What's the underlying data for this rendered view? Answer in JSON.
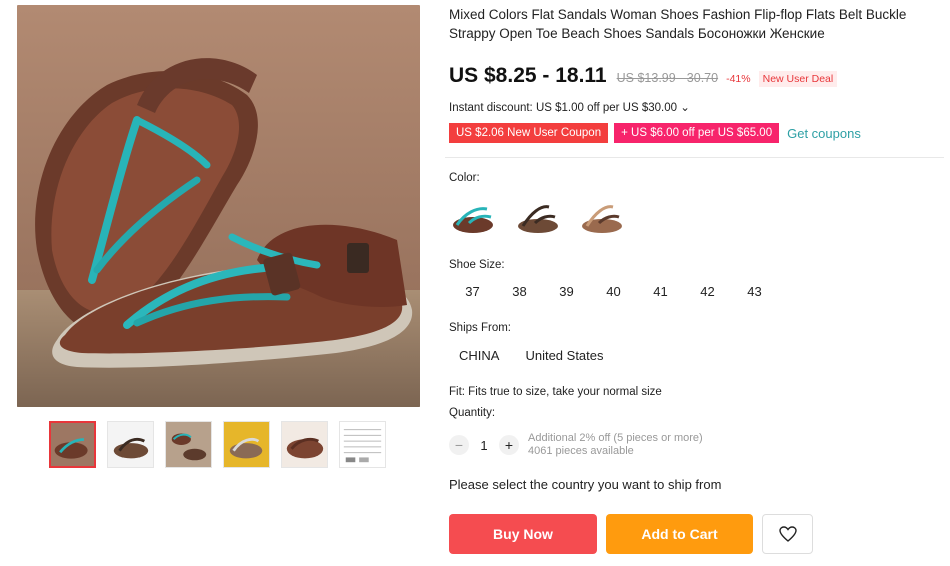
{
  "product": {
    "title": "Mixed Colors Flat Sandals Woman Shoes Fashion Flip-flop Flats Belt Buckle Strappy Open Toe Beach Shoes Sandals Босоножки Женские",
    "price": "US $8.25 - 18.11",
    "original_price": "US $13.99 - 30.70",
    "discount_pct": "-41%",
    "deal_badge": "New User Deal"
  },
  "discount_line": "Instant discount: US $1.00 off per US $30.00 ⌄",
  "coupons": {
    "new_user": "US $2.06 New User Coupon",
    "store": "+ US $6.00 off per US $65.00",
    "get": "Get coupons"
  },
  "color": {
    "label": "Color:"
  },
  "shoe_size": {
    "label": "Shoe Size:",
    "options": [
      "37",
      "38",
      "39",
      "40",
      "41",
      "42",
      "43"
    ]
  },
  "ships_from": {
    "label": "Ships From:",
    "options": [
      "CHINA",
      "United States"
    ]
  },
  "fit": "Fit: Fits true to size, take your normal size",
  "quantity": {
    "label": "Quantity:",
    "minus": "−",
    "value": "1",
    "plus": "+",
    "note1": "Additional 2% off (5 pieces or more)",
    "note2": "4061 pieces available"
  },
  "ship_msg": "Please select the country you want to ship from",
  "buttons": {
    "buy": "Buy Now",
    "cart": "Add to Cart"
  },
  "colors_hex": {
    "accent": "#f54c50",
    "cart": "#ff9b0e",
    "teal": "#2ea0a5"
  }
}
